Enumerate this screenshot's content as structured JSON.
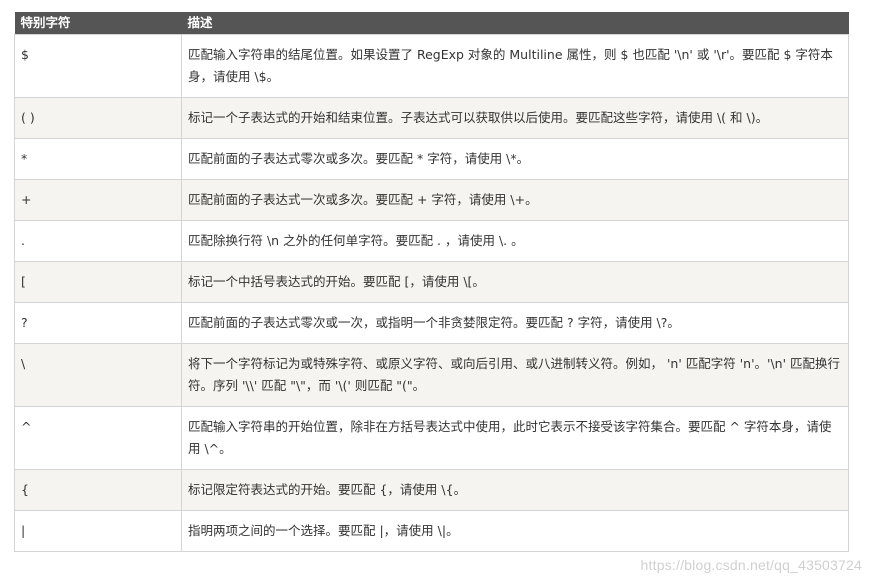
{
  "table": {
    "headers": [
      "特别字符",
      "描述"
    ],
    "rows": [
      {
        "char": "$",
        "desc": "匹配输入字符串的结尾位置。如果设置了 RegExp 对象的 Multiline 属性，则 $ 也匹配 '\\n' 或 '\\r'。要匹配 $ 字符本身，请使用 \\$。"
      },
      {
        "char": "( )",
        "desc": "标记一个子表达式的开始和结束位置。子表达式可以获取供以后使用。要匹配这些字符，请使用 \\( 和 \\)。"
      },
      {
        "char": "*",
        "desc": "匹配前面的子表达式零次或多次。要匹配 * 字符，请使用 \\*。"
      },
      {
        "char": "+",
        "desc": "匹配前面的子表达式一次或多次。要匹配 + 字符，请使用 \\+。"
      },
      {
        "char": ".",
        "desc": "匹配除换行符 \\n 之外的任何单字符。要匹配 . ，请使用 \\. 。"
      },
      {
        "char": "[",
        "desc": "标记一个中括号表达式的开始。要匹配 [，请使用 \\[。"
      },
      {
        "char": "?",
        "desc": "匹配前面的子表达式零次或一次，或指明一个非贪婪限定符。要匹配 ? 字符，请使用 \\?。"
      },
      {
        "char": "\\",
        "desc": "将下一个字符标记为或特殊字符、或原义字符、或向后引用、或八进制转义符。例如， 'n' 匹配字符 'n'。'\\n' 匹配换行符。序列 '\\\\' 匹配 \"\\\"，而 '\\(' 则匹配 \"(\"。"
      },
      {
        "char": "^",
        "desc": "匹配输入字符串的开始位置，除非在方括号表达式中使用，此时它表示不接受该字符集合。要匹配 ^ 字符本身，请使用 \\^。"
      },
      {
        "char": "{",
        "desc": "标记限定符表达式的开始。要匹配 {，请使用 \\{。"
      },
      {
        "char": "|",
        "desc": "指明两项之间的一个选择。要匹配 |，请使用 \\|。"
      }
    ]
  },
  "watermark": "https://blog.csdn.net/qq_43503724"
}
